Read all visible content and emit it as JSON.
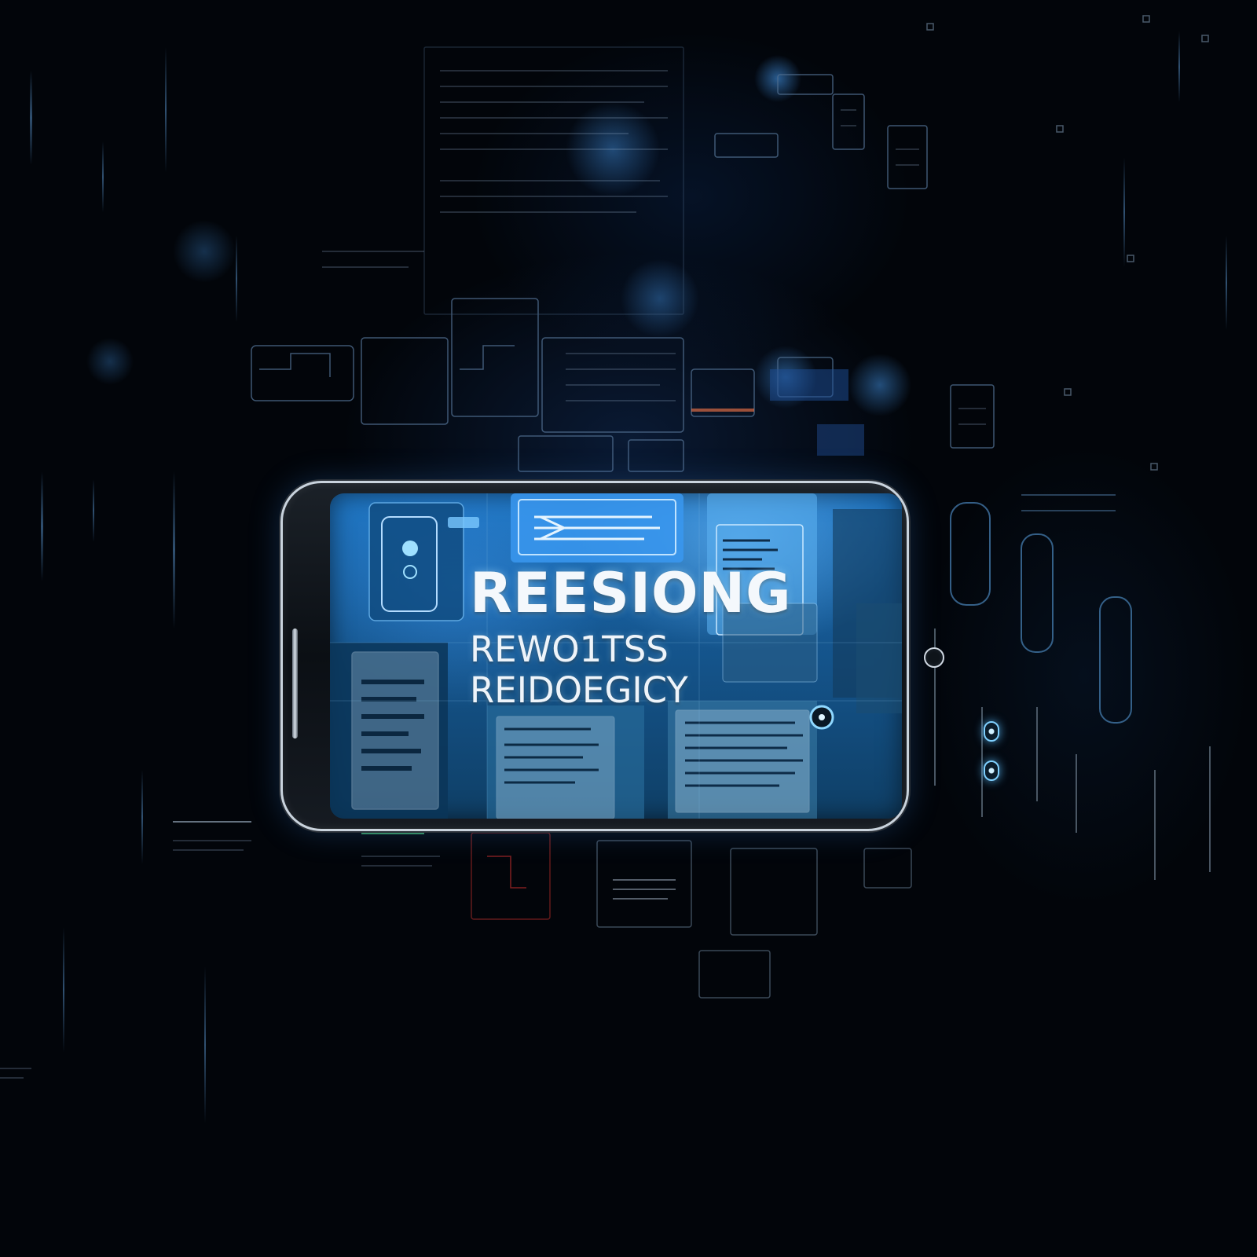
{
  "screen": {
    "headline": "REESIONG",
    "subline_1": "REWO1TSS",
    "subline_2": "REIDOEGICY"
  },
  "colors": {
    "background": "#02050a",
    "screen_glow": "#1f76c4",
    "accent_blue": "#3fa0ff",
    "phone_rim": "#c9d3dd",
    "headline_text": "#f4f8fc"
  },
  "icons": [
    "circuit-panel-icon",
    "document-card-icon",
    "lens-icon",
    "home-button-icon"
  ]
}
